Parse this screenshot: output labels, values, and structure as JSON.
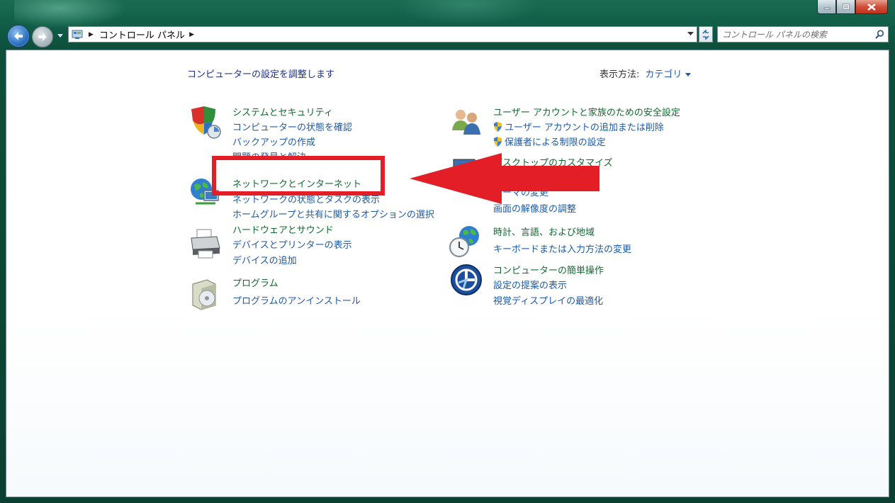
{
  "window": {
    "breadcrumb": [
      "コントロール パネル"
    ],
    "search_placeholder": "コントロール パネルの検索"
  },
  "page": {
    "heading": "コンピューターの設定を調整します",
    "view_by_label": "表示方法:",
    "view_by_value": "カテゴリ"
  },
  "categories": [
    {
      "title": "システムとセキュリティ",
      "icon": "shield-icon",
      "links": [
        "コンピューターの状態を確認",
        "バックアップの作成",
        "問題の発見と解決"
      ]
    },
    {
      "title": "ネットワークとインターネット",
      "icon": "network-globe-icon",
      "links": [
        "ネットワークの状態とタスクの表示",
        "ホームグループと共有に関するオプションの選択"
      ]
    },
    {
      "title": "ハードウェアとサウンド",
      "icon": "printer-icon",
      "links": [
        "デバイスとプリンターの表示",
        "デバイスの追加"
      ]
    },
    {
      "title": "プログラム",
      "icon": "programs-icon",
      "links": [
        "プログラムのアンインストール"
      ]
    },
    {
      "title": "ユーザー アカウントと家族のための安全設定",
      "icon": "users-icon",
      "links": [
        "ユーザー アカウントの追加または削除",
        "保護者による制限の設定"
      ]
    },
    {
      "title": "デスクトップのカスタマイズ",
      "icon": "desktop-icon",
      "links": [
        "テーマの変更",
        "画面の解像度の調整"
      ]
    },
    {
      "title": "時計、言語、および地域",
      "icon": "clock-globe-icon",
      "links": [
        "キーボードまたは入力方法の変更"
      ]
    },
    {
      "title": "コンピューターの簡単操作",
      "icon": "ease-of-access-icon",
      "links": [
        "設定の提案の表示",
        "視覚ディスプレイの最適化"
      ]
    }
  ],
  "annotation": {
    "color": "#e31e26"
  }
}
